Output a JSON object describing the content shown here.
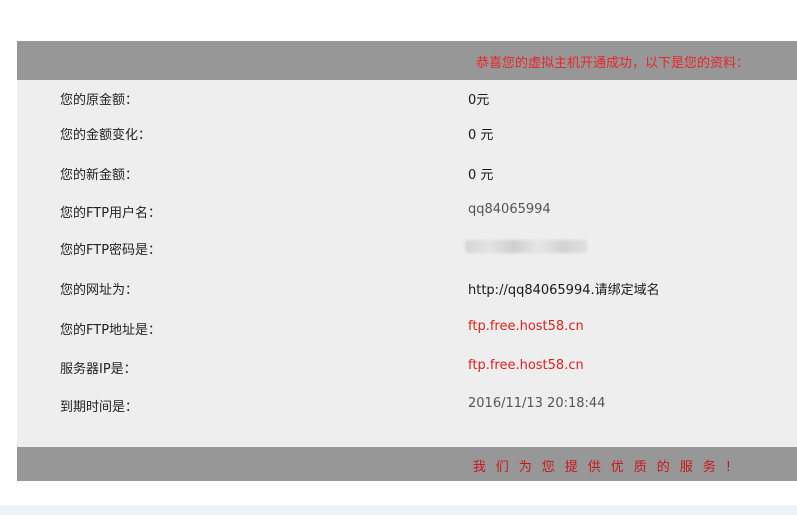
{
  "header": {
    "title": "恭喜您的虚拟主机开通成功，以下是您的资料："
  },
  "rows": [
    {
      "label": "您的原金额：",
      "value": "0元"
    },
    {
      "label": "您的金额变化：",
      "value": "0 元"
    },
    {
      "label": "您的新金额：",
      "value": "0 元"
    },
    {
      "label": "您的FTP用户名：",
      "value": "qq84065994"
    },
    {
      "label": "您的FTP密码是：",
      "value": ""
    },
    {
      "label": "您的网址为：",
      "value": "http://qq84065994.请绑定域名"
    },
    {
      "label": "您的FTP地址是：",
      "value": "ftp.free.host58.cn"
    },
    {
      "label": "服务器IP是：",
      "value": "ftp.free.host58.cn"
    },
    {
      "label": "到期时间是：",
      "value": "2016/11/13 20:18:44"
    }
  ],
  "footer": {
    "slogan": "我们为您提供优质的服务!"
  },
  "colors": {
    "bar": "#979797",
    "panel": "#eeeeee",
    "header_text": "#e8262a",
    "link_red": "#e0201f",
    "footer_text": "#c8171c"
  }
}
